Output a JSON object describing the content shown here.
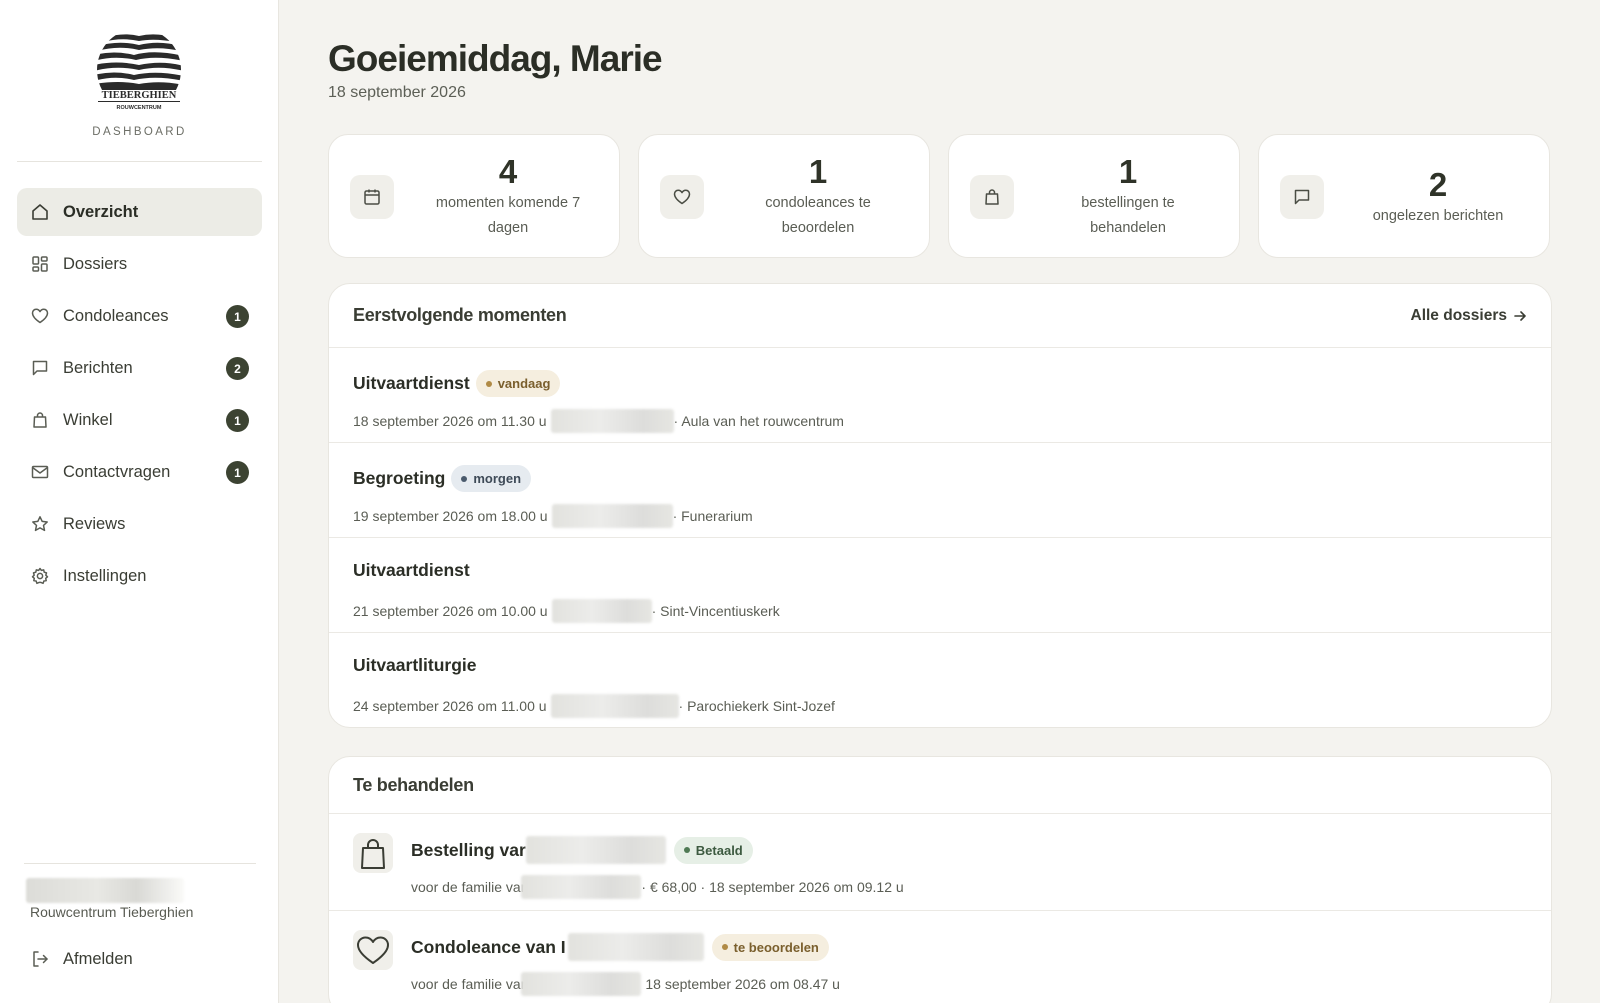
{
  "sidebar": {
    "logo_text": "TIEBERGHIEN",
    "logo_subtext": "ROUWCENTRUM",
    "subtitle": "DASHBOARD",
    "items": [
      {
        "label": "Overzicht",
        "icon": "home-icon",
        "active": true,
        "badge": ""
      },
      {
        "label": "Dossiers",
        "icon": "grid-icon",
        "badge": ""
      },
      {
        "label": "Condoleances",
        "icon": "heart-icon",
        "badge": "1"
      },
      {
        "label": "Berichten",
        "icon": "message-icon",
        "badge": "2"
      },
      {
        "label": "Winkel",
        "icon": "shopping-bag-icon",
        "badge": "1"
      },
      {
        "label": "Contactvragen",
        "icon": "mail-icon",
        "badge": "1"
      },
      {
        "label": "Reviews",
        "icon": "star-icon",
        "badge": ""
      },
      {
        "label": "Instellingen",
        "icon": "gear-icon",
        "badge": ""
      }
    ],
    "organization": "Rouwcentrum Tieberghien",
    "logout_label": "Afmelden"
  },
  "header": {
    "greeting": "Goeiemiddag, Marie",
    "date": "18 september 2026"
  },
  "stats": [
    {
      "value": "4",
      "label": "momenten komende 7 dagen",
      "icon": "calendar-icon"
    },
    {
      "value": "1",
      "label": "condoleances te beoordelen",
      "icon": "heart-icon"
    },
    {
      "value": "1",
      "label": "bestellingen te behandelen",
      "icon": "shopping-bag-icon"
    },
    {
      "value": "2",
      "label": "ongelezen berichten",
      "icon": "message-icon"
    }
  ],
  "moments": {
    "title": "Eerstvolgende momenten",
    "link_label": "Alle dossiers",
    "items": [
      {
        "title": "Uitvaartdienst",
        "tag": "vandaag",
        "when": "18 september 2026 om 11.30 u",
        "location": "· Aula van het rouwcentrum"
      },
      {
        "title": "Begroeting",
        "tag": "morgen",
        "when": "19 september 2026 om 18.00 u",
        "location": "· Funerarium"
      },
      {
        "title": "Uitvaartdienst",
        "tag": "",
        "when": "21 september 2026 om 10.00 u",
        "location": "· Sint-Vincentiuskerk"
      },
      {
        "title": "Uitvaartliturgie",
        "tag": "",
        "when": "24 september 2026 om 11.00 u",
        "location": "· Parochiekerk Sint-Jozef"
      }
    ]
  },
  "tasks": {
    "title": "Te behandelen",
    "items": [
      {
        "title": "Bestelling var",
        "tag": "Betaald",
        "icon": "shopping-bag-icon",
        "meta_prefix": "voor de familie var",
        "meta_suffix": "· € 68,00 · 18 september 2026 om 09.12 u"
      },
      {
        "title": "Condoleance van I",
        "tag": "te beoordelen",
        "icon": "heart-icon",
        "meta_prefix": "voor de familie var",
        "meta_suffix": "18 september 2026 om 08.47 u"
      }
    ]
  },
  "colors": {
    "background": "#f4f3ef",
    "badge": "#3c4332",
    "active_nav": "#ecece6"
  }
}
